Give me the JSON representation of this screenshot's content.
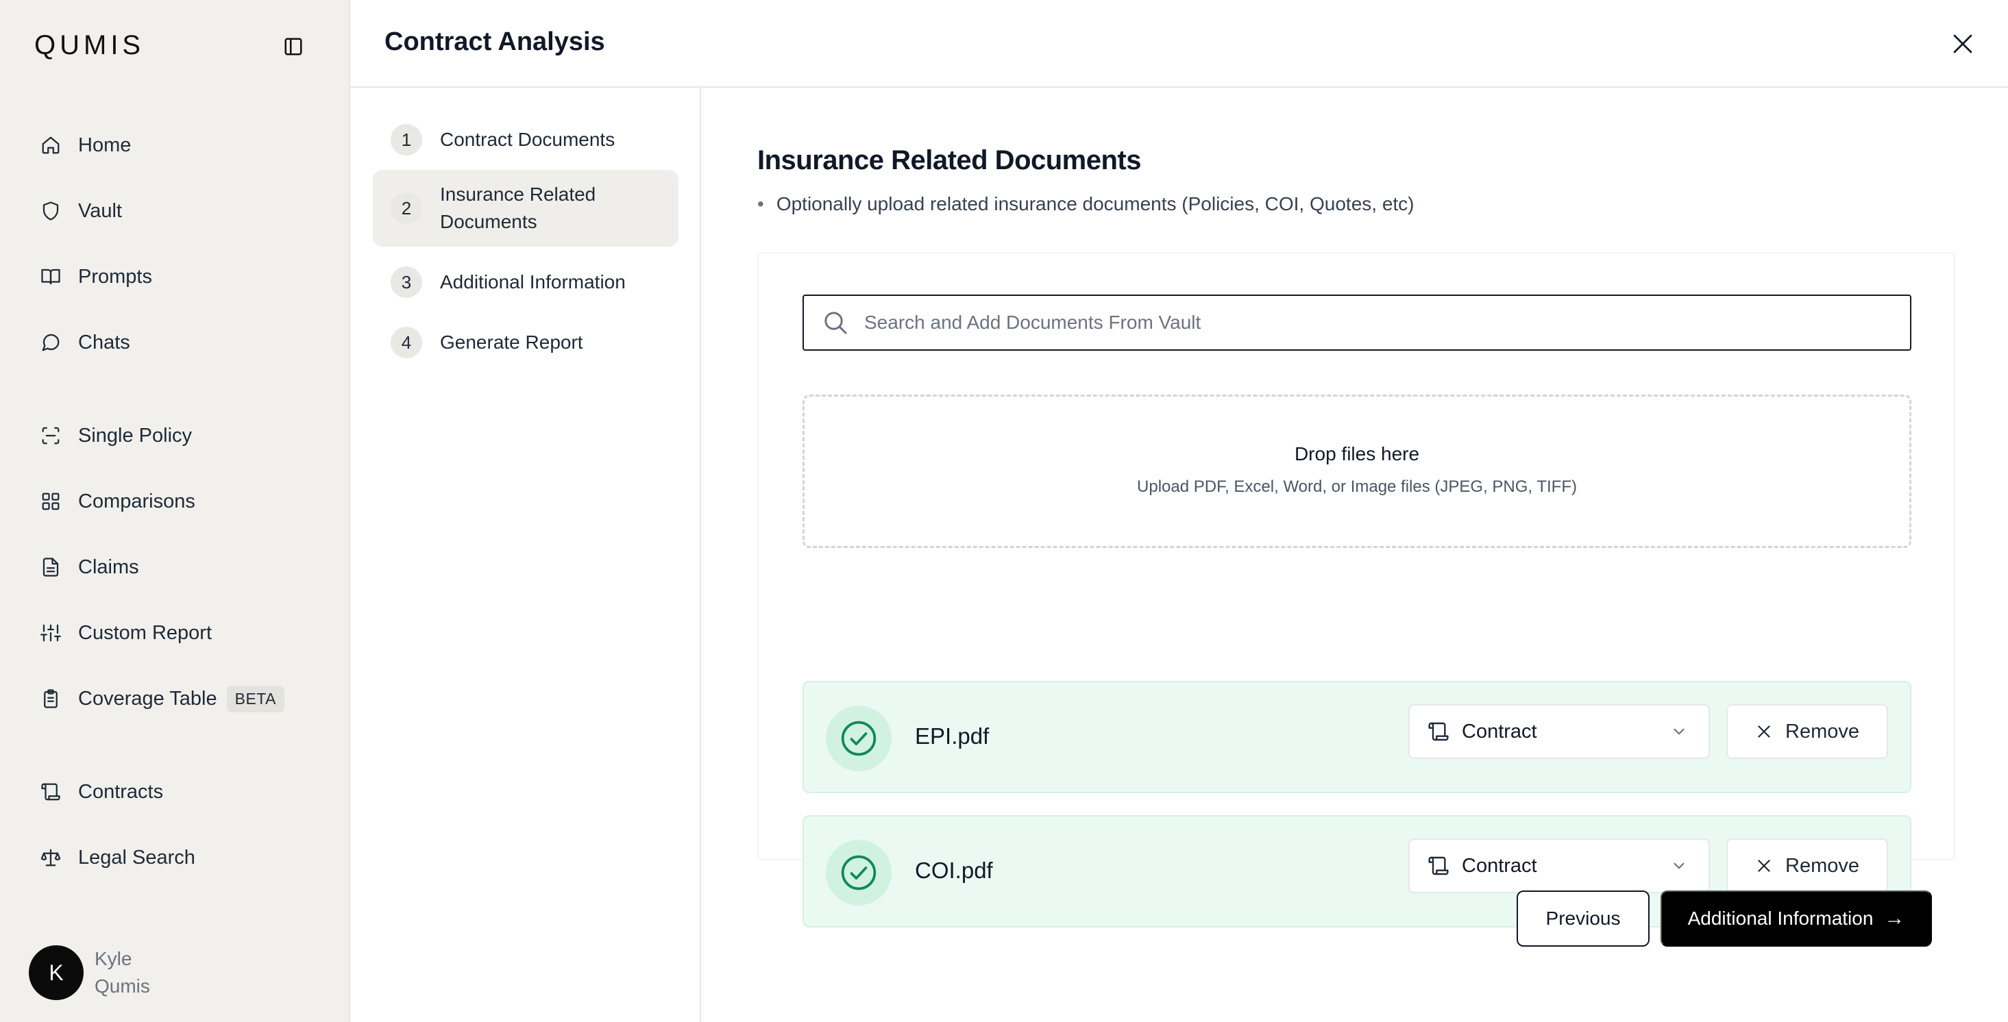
{
  "app": {
    "logo": "QUMIS",
    "colors": {
      "accent": "#000000",
      "success_bg": "#eafaf2",
      "success_icon": "#0f8a56",
      "sidebar_bg": "#f1f0ec"
    }
  },
  "sidebar": {
    "items": [
      {
        "label": "Home",
        "icon": "home-icon"
      },
      {
        "label": "Vault",
        "icon": "shield-icon"
      },
      {
        "label": "Prompts",
        "icon": "book-icon"
      },
      {
        "label": "Chats",
        "icon": "chat-icon"
      },
      {
        "label": "Single Policy",
        "icon": "scan-icon"
      },
      {
        "label": "Comparisons",
        "icon": "grid-icon"
      },
      {
        "label": "Claims",
        "icon": "document-icon"
      },
      {
        "label": "Custom Report",
        "icon": "sliders-icon"
      },
      {
        "label": "Coverage Table",
        "icon": "clipboard-icon",
        "badge": "BETA"
      },
      {
        "label": "Contracts",
        "icon": "scroll-icon"
      },
      {
        "label": "Legal Search",
        "icon": "scale-icon"
      }
    ],
    "user": {
      "initial": "K",
      "first_name": "Kyle",
      "last_name": "Qumis"
    }
  },
  "header": {
    "title": "Contract Analysis"
  },
  "steps": [
    {
      "num": "1",
      "label": "Contract Documents",
      "active": false
    },
    {
      "num": "2",
      "label": "Insurance Related Documents",
      "active": true
    },
    {
      "num": "3",
      "label": "Additional Information",
      "active": false
    },
    {
      "num": "4",
      "label": "Generate Report",
      "active": false
    }
  ],
  "main": {
    "title": "Insurance Related Documents",
    "description": "Optionally upload related insurance documents (Policies, COI, Quotes, etc)",
    "search": {
      "placeholder": "Search and Add Documents From Vault",
      "value": ""
    },
    "dropzone": {
      "title": "Drop files here",
      "subtitle": "Upload PDF, Excel, Word, or Image files (JPEG, PNG, TIFF)"
    },
    "files": [
      {
        "name": "EPI.pdf",
        "type": "Contract",
        "remove_label": "Remove"
      },
      {
        "name": "COI.pdf",
        "type": "Contract",
        "remove_label": "Remove"
      }
    ],
    "buttons": {
      "previous": "Previous",
      "next": "Additional Information",
      "next_arrow": "→"
    }
  }
}
